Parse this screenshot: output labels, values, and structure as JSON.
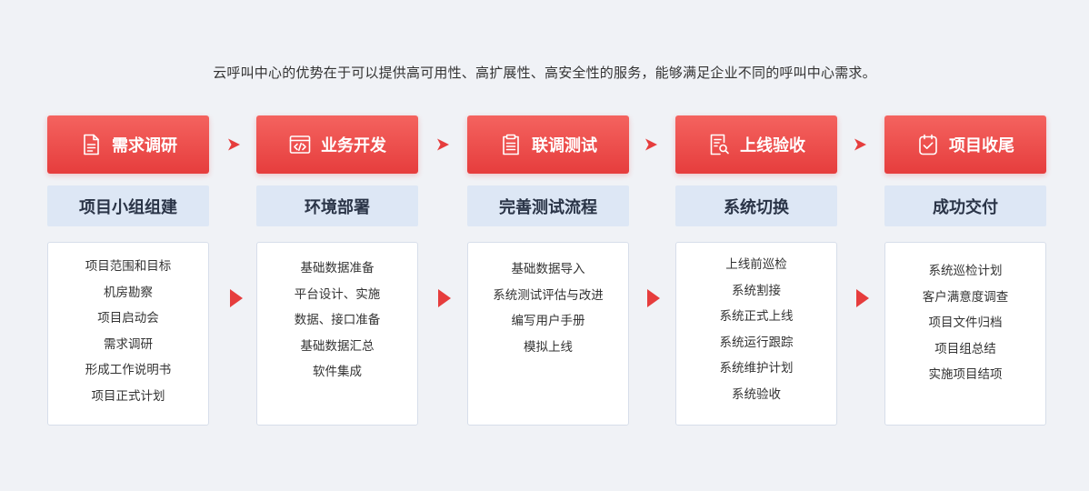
{
  "subtitle": "云呼叫中心的优势在于可以提供高可用性、高扩展性、高安全性的服务，能够满足企业不同的呼叫中心需求。",
  "accent_color": "#e63d3d",
  "stages": [
    {
      "title": "需求调研",
      "icon": "document-icon",
      "phase": "项目小组组建",
      "items": [
        "项目范围和目标",
        "机房勘察",
        "项目启动会",
        "需求调研",
        "形成工作说明书",
        "项目正式计划"
      ]
    },
    {
      "title": "业务开发",
      "icon": "code-window-icon",
      "phase": "环境部署",
      "items": [
        "基础数据准备",
        "平台设计、实施",
        "数据、接口准备",
        "基础数据汇总",
        "软件集成"
      ]
    },
    {
      "title": "联调测试",
      "icon": "clipboard-list-icon",
      "phase": "完善测试流程",
      "items": [
        "基础数据导入",
        "系统测试评估与改进",
        "编写用户手册",
        "模拟上线"
      ]
    },
    {
      "title": "上线验收",
      "icon": "document-search-icon",
      "phase": "系统切换",
      "items": [
        "上线前巡检",
        "系统割接",
        "系统正式上线",
        "系统运行跟踪",
        "系统维护计划",
        "系统验收"
      ]
    },
    {
      "title": "项目收尾",
      "icon": "clipboard-check-icon",
      "phase": "成功交付",
      "items": [
        "系统巡检计划",
        "客户满意度调查",
        "项目文件归档",
        "项目组总结",
        "实施项目结项"
      ]
    }
  ]
}
